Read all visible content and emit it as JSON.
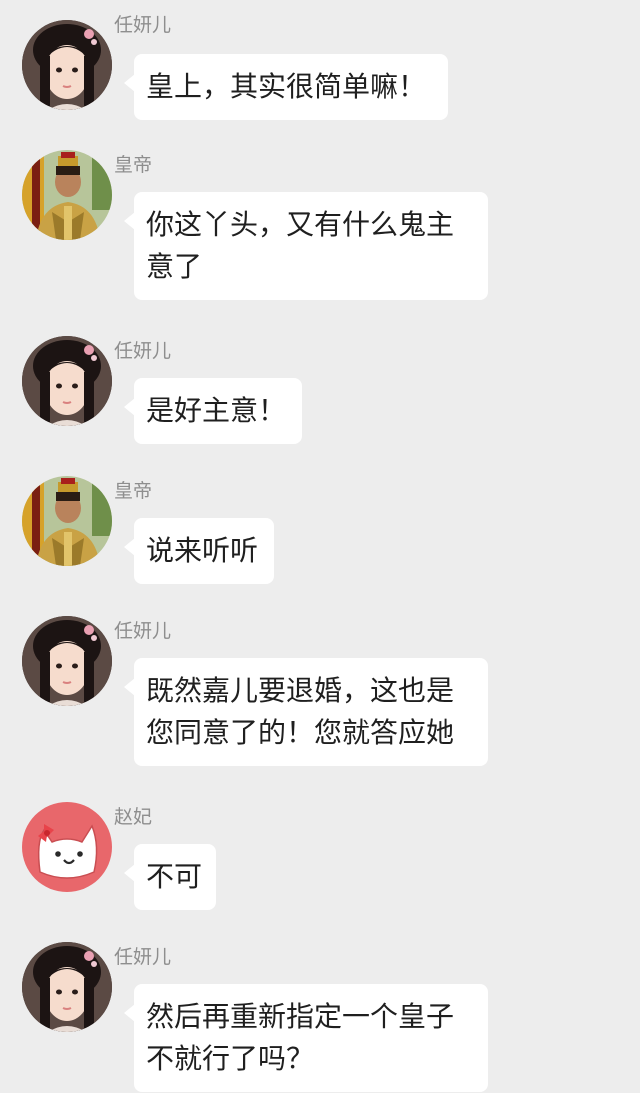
{
  "chat": {
    "messages": [
      {
        "sender": "任妍儿",
        "avatar": "girl-avatar",
        "text": "皇上，其实很简单嘛！"
      },
      {
        "sender": "皇帝",
        "avatar": "emperor-avatar",
        "text": "你这丫头，又有什么鬼主\n意了"
      },
      {
        "sender": "任妍儿",
        "avatar": "girl-avatar",
        "text": "是好主意！"
      },
      {
        "sender": "皇帝",
        "avatar": "emperor-avatar",
        "text": "说来听听"
      },
      {
        "sender": "任妍儿",
        "avatar": "girl-avatar",
        "text": "既然嘉儿要退婚，这也是\n您同意了的！您就答应她"
      },
      {
        "sender": "赵妃",
        "avatar": "cat-avatar",
        "text": "不可"
      },
      {
        "sender": "任妍儿",
        "avatar": "girl-avatar",
        "text": "然后再重新指定一个皇子\n不就行了吗？"
      }
    ]
  },
  "colors": {
    "background": "#ededed",
    "bubble": "#ffffff",
    "name_text": "#8e8e8e",
    "message_text": "#1f1f1f",
    "cat_avatar_bg": "#e8676b"
  }
}
